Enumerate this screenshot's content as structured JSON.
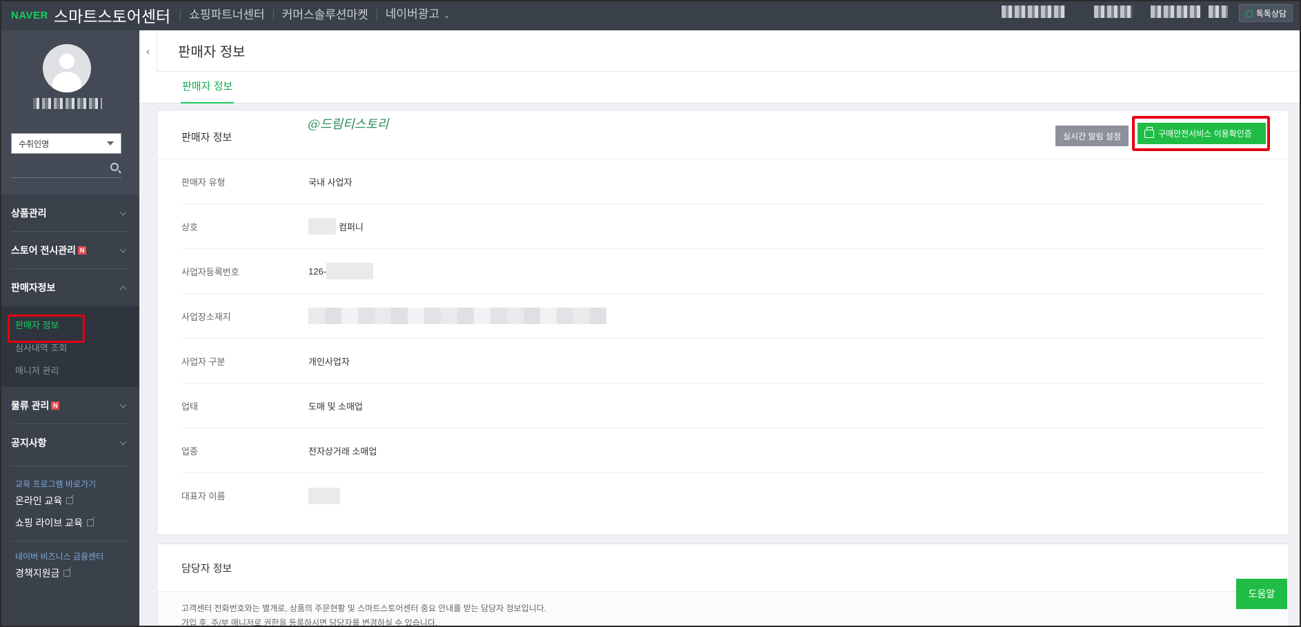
{
  "topbar": {
    "brand": "NAVER",
    "title": "스마트스토어센터",
    "links": [
      "쇼핑파트너센터",
      "커머스솔루션마켓",
      "네이버광고"
    ],
    "talk_button": "톡톡상담"
  },
  "sidebar": {
    "seller_select": "수취인명",
    "menu": [
      {
        "label": "상품관리",
        "badge": ""
      },
      {
        "label": "스토어 전시관리",
        "badge": "N"
      },
      {
        "label": "판매자정보",
        "badge": ""
      }
    ],
    "sub_menu": [
      "판매자 정보",
      "심사내역 조회",
      "매니저 관리"
    ],
    "menu2": [
      {
        "label": "물류 관리",
        "badge": "N"
      },
      {
        "label": "공지사항",
        "badge": ""
      }
    ],
    "edu_section_label": "교육 프로그램 바로가기",
    "edu_links": [
      "온라인 교육",
      "쇼핑 라이브 교육"
    ],
    "biz_section_label": "네이버 비즈니스 금융센터",
    "biz_links": [
      "경책지원금"
    ]
  },
  "header": {
    "collapse": "‹",
    "page_title": "판매자 정보",
    "tab": "판매자 정보"
  },
  "seller_card": {
    "title": "판매자 정보",
    "watermark": "@드림티스토리",
    "alert_button": "실시간 알림 설정",
    "verify_button": "구매안전서비스 이용확인증",
    "rows": [
      {
        "label": "판매자 유형",
        "value": "국내 사업자"
      },
      {
        "label": "상호",
        "value": "컴퍼니"
      },
      {
        "label": "사업자등록번호",
        "value": "126-"
      },
      {
        "label": "사업장소재지",
        "value": ""
      },
      {
        "label": "사업자 구분",
        "value": "개인사업자"
      },
      {
        "label": "업태",
        "value": "도매 및 소매업"
      },
      {
        "label": "업종",
        "value": "전자상거래 소매업"
      },
      {
        "label": "대표자 이름",
        "value": ""
      }
    ]
  },
  "manager_card": {
    "title": "담당자 정보",
    "desc1": "고객센터 전화번호와는 별개로, 상품의 주문현황 및 스마트스토어센터 중요 안내를 받는 담당자 정보입니다.",
    "desc2": "가입 후, 주/부 매니저로 권한을 등록하시면 담당자를 변경하실 수 있습니다."
  },
  "help_button": "도움말"
}
